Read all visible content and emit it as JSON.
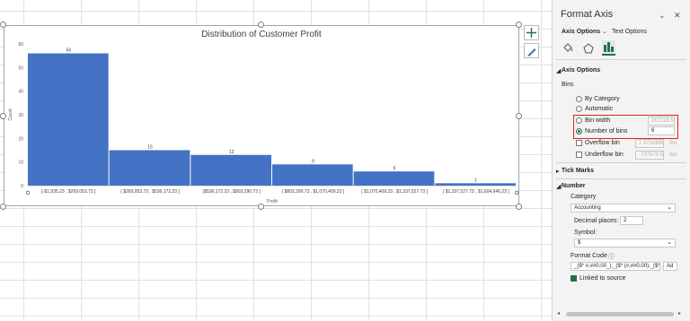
{
  "pane": {
    "title": "Format Axis",
    "tab_axis_options": "Axis Options",
    "tab_text_options": "Text Options",
    "section_axis_options": "Axis Options",
    "bins_label": "Bins",
    "by_category": "By Category",
    "automatic": "Automatic",
    "bin_width": "Bin width",
    "bin_width_value": "267118.5",
    "number_of_bins": "Number of bins",
    "number_of_bins_value": "6",
    "overflow_bin": "Overflow bin",
    "overflow_value": "1.4710866",
    "underflow_bin": "Underflow bin",
    "underflow_value": "-737670.5",
    "auto_short": "Au",
    "section_tick_marks": "Tick Marks",
    "section_number": "Number",
    "category_label": "Category",
    "category_value": "Accounting",
    "decimal_label": "Decimal places:",
    "decimal_value": "2",
    "symbol_label": "Symbol:",
    "symbol_value": "$",
    "format_code_label": "Format Code",
    "format_code_value": "_($* #,##0.00_);_($* (#,##0.00);_($*",
    "add_button": "Ad",
    "linked_label": "Linked to source"
  },
  "selected_bins_option": "number_of_bins",
  "linked_to_source": true,
  "colors": {
    "bar": "#4472C4",
    "accent": "#217346",
    "highlight": "#E02020"
  },
  "chart_data": {
    "type": "bar",
    "title": "Distribution of Customer Profit",
    "xlabel": "Profit",
    "ylabel": "Count",
    "ylim": [
      0,
      60
    ],
    "yticks": [
      0,
      10,
      20,
      30,
      40,
      50,
      60
    ],
    "categories": [
      "[-$1,935.23 , $269,053.73 ]",
      "( $269,053.73 , $536,172.23 ]",
      "($536,172.23 , $803,290.73 ]",
      "( $803,290.73 , $1,070,409.23 ]",
      "( $1,070,409.23 , $1,337,527.73 ]",
      "( $1,337,527.73 , $1,604,646.23 ]"
    ],
    "values": [
      56,
      15,
      13,
      9,
      6,
      1
    ],
    "grid": false
  }
}
